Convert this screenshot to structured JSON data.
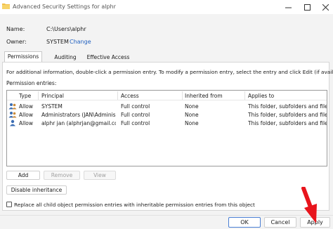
{
  "window": {
    "title": "Advanced Security Settings for alphr",
    "icon": "folder-icon",
    "controls": [
      "minimize-icon",
      "maximize-icon",
      "close-icon"
    ]
  },
  "info": {
    "name_label": "Name:",
    "name_value": "C:\\Users\\alphr",
    "owner_label": "Owner:",
    "owner_value": "SYSTEM",
    "change_link": "Change"
  },
  "tabs": [
    {
      "label": "Permissions",
      "active": true
    },
    {
      "label": "Auditing",
      "active": false
    },
    {
      "label": "Effective Access",
      "active": false
    }
  ],
  "instructions": "For additional information, double-click a permission entry. To modify a permission entry, select the entry and click Edit (if available).",
  "entries_label": "Permission entries:",
  "table": {
    "headers": [
      "Type",
      "Principal",
      "Access",
      "Inherited from",
      "Applies to"
    ],
    "rows": [
      {
        "type": "Allow",
        "principal": "SYSTEM",
        "access": "Full control",
        "inherited": "None",
        "applies": "This folder, subfolders and files",
        "icon": "group-users-icon"
      },
      {
        "type": "Allow",
        "principal": "Administrators (JAN\\Adminis...",
        "access": "Full control",
        "inherited": "None",
        "applies": "This folder, subfolders and files",
        "icon": "group-users-icon"
      },
      {
        "type": "Allow",
        "principal": "alphr jan (alphrjan@gmail.co...",
        "access": "Full control",
        "inherited": "None",
        "applies": "This folder, subfolders and files",
        "icon": "single-user-icon"
      }
    ]
  },
  "buttons": {
    "add": "Add",
    "remove": "Remove",
    "view": "View",
    "disable_inheritance": "Disable inheritance"
  },
  "replace_checkbox": {
    "label": "Replace all child object permission entries with inheritable permission entries from this object",
    "checked": false
  },
  "dialog_buttons": {
    "ok": "OK",
    "cancel": "Cancel",
    "apply": "Apply"
  },
  "colors": {
    "link": "#1f5fbf",
    "annotation_arrow": "#e8141c",
    "primary_border": "#4a7fd4"
  }
}
